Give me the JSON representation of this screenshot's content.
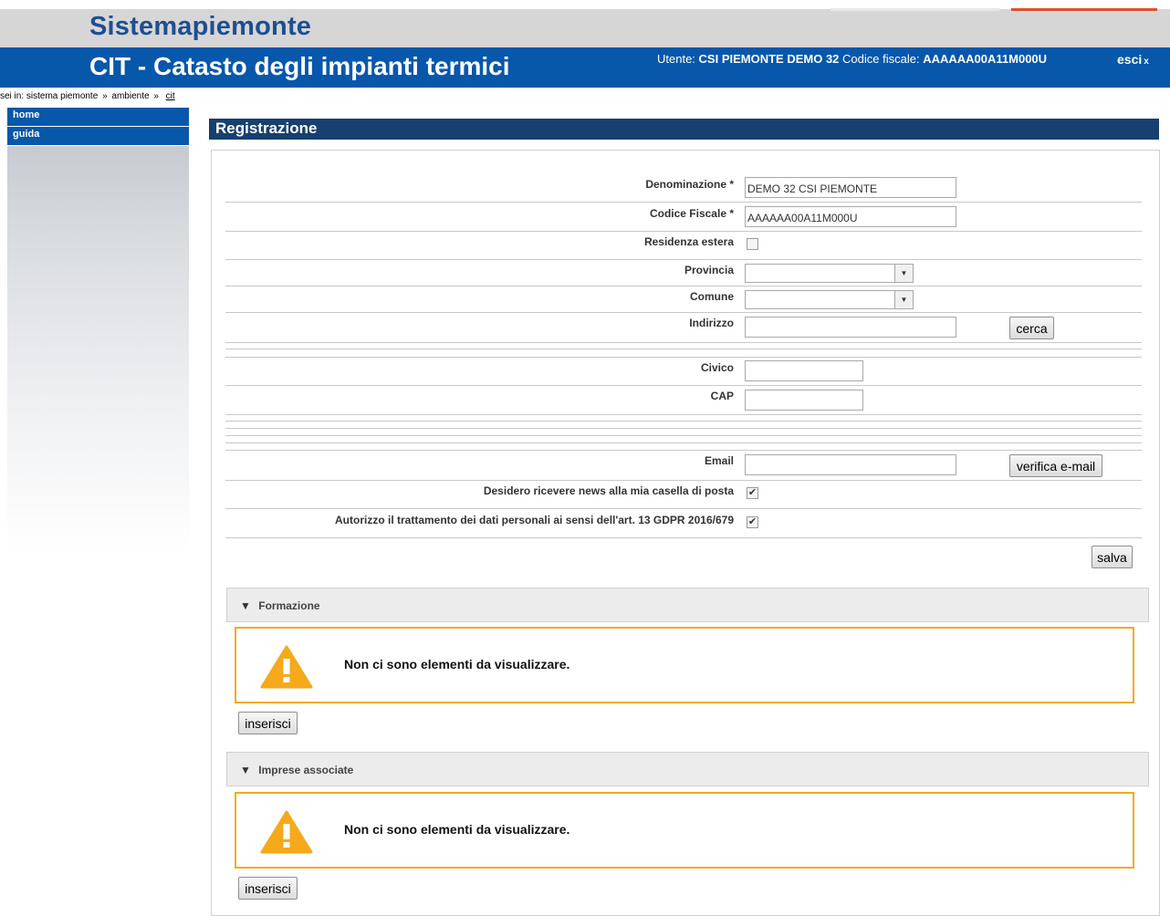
{
  "header": {
    "site_title": "Sistemapiemonte",
    "app_title": "CIT - Catasto degli impianti termici",
    "user_label": "Utente:",
    "user_name": "CSI PIEMONTE DEMO 32",
    "cf_label": "Codice fiscale:",
    "cf_value": "AAAAAA00A11M000U",
    "logout_label": "esci",
    "logout_icon": "x"
  },
  "breadcrumb": {
    "prefix": "sei in:",
    "items": [
      "sistema piemonte",
      "ambiente"
    ],
    "current": "cit",
    "separator": "»"
  },
  "sidebar": {
    "items": [
      {
        "label": "home"
      },
      {
        "label": "guida"
      }
    ]
  },
  "page": {
    "section_title": "Registrazione"
  },
  "form": {
    "denominazione": {
      "label": "Denominazione *",
      "value": "DEMO 32 CSI PIEMONTE"
    },
    "codice_fiscale": {
      "label": "Codice Fiscale *",
      "value": "AAAAAA00A11M000U"
    },
    "residenza_estera": {
      "label": "Residenza estera",
      "checked": false
    },
    "provincia": {
      "label": "Provincia",
      "value": ""
    },
    "comune": {
      "label": "Comune",
      "value": ""
    },
    "indirizzo": {
      "label": "Indirizzo",
      "value": "",
      "button": "cerca"
    },
    "civico": {
      "label": "Civico",
      "value": ""
    },
    "cap": {
      "label": "CAP",
      "value": ""
    },
    "email": {
      "label": "Email",
      "value": "",
      "button": "verifica e-mail"
    },
    "news": {
      "label": "Desidero ricevere news alla mia casella di posta",
      "checked": true
    },
    "privacy": {
      "label": "Autorizzo il trattamento dei dati personali ai sensi dell'art. 13 GDPR 2016/679",
      "checked": true
    },
    "save_label": "salva"
  },
  "sections": [
    {
      "title": "Formazione",
      "empty_message": "Non ci sono elementi da visualizzare.",
      "insert_label": "inserisci"
    },
    {
      "title": "Imprese associate",
      "empty_message": "Non ci sono elementi da visualizzare.",
      "insert_label": "inserisci"
    }
  ],
  "colors": {
    "brand_blue": "#0757ab",
    "site_title_blue": "#1d4f91",
    "section_header": "#173f70",
    "warning_orange": "#f5a91b"
  },
  "icons": {
    "warning": "warning-triangle-icon",
    "collapse": "triangle-down-icon",
    "dropdown": "chevron-down-icon",
    "check": "checkmark-icon"
  }
}
